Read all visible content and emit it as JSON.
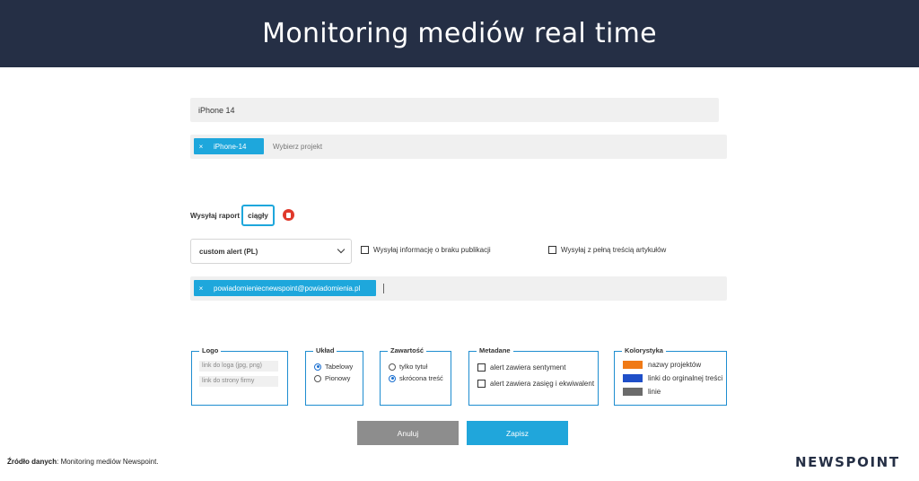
{
  "header": {
    "title": "Monitoring mediów real time"
  },
  "form": {
    "name_value": "iPhone 14",
    "project_chip": "iPhone-14",
    "project_placeholder": "Wybierz projekt",
    "chip_remove": "×",
    "report_label": "Wysyłaj raport",
    "report_value": "ciągły",
    "alert_select": "custom alert (PL)",
    "no_publication_label": "Wysyłaj informację o braku publikacji",
    "full_content_label": "Wysyłaj z pełną treścią artykułów",
    "email_chip": "powiadomieniecnewspoint@powiadomienia.pl"
  },
  "panels": {
    "logo": {
      "legend": "Logo",
      "logo_link_placeholder": "link do loga (jpg, png)",
      "company_link_placeholder": "link do strony firmy"
    },
    "layout": {
      "legend": "Układ",
      "options": [
        "Tabelowy",
        "Pionowy"
      ],
      "selected": "Tabelowy"
    },
    "content": {
      "legend": "Zawartość",
      "options": [
        "tylko tytuł",
        "skrócona treść"
      ],
      "selected": "skrócona treść"
    },
    "metadata": {
      "legend": "Metadane",
      "options": [
        "alert zawiera sentyment",
        "alert zawiera zasięg i ekwiwalent"
      ]
    },
    "colors": {
      "legend": "Kolorystyka",
      "items": [
        {
          "label": "nazwy projektów",
          "color": "#f07a16"
        },
        {
          "label": "linki do orginalnej treści",
          "color": "#1f4fc8"
        },
        {
          "label": "linie",
          "color": "#6b6b6b"
        }
      ]
    }
  },
  "buttons": {
    "cancel": "Anuluj",
    "save": "Zapisz"
  },
  "footer": {
    "source_bold": "Źródło danych",
    "source_text": ": Monitoring mediów Newspoint.",
    "logo_text": "NEWSPOINT"
  }
}
